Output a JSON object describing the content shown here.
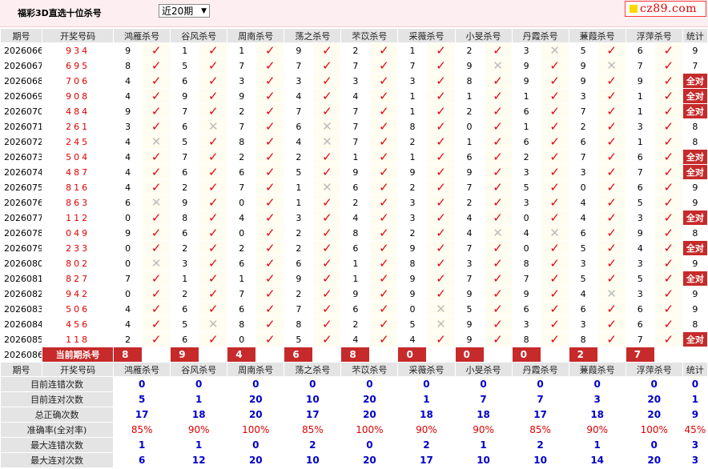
{
  "header": {
    "title": "福彩3D直选十位杀号",
    "period_select": "近20期",
    "logo_text": "cz89.com"
  },
  "columns": [
    "期号",
    "开奖号码",
    "鸿雁杀号",
    "谷风杀号",
    "周南杀号",
    "荡之杀号",
    "芣苡杀号",
    "采薇杀号",
    "小旻杀号",
    "丹霞杀号",
    "蒹葭杀号",
    "浮萍杀号",
    "统计"
  ],
  "rows": [
    {
      "issue": "2026066",
      "win": "934",
      "kills": [
        [
          "9",
          1
        ],
        [
          "1",
          1
        ],
        [
          "1",
          1
        ],
        [
          "9",
          1
        ],
        [
          "2",
          1
        ],
        [
          "1",
          1
        ],
        [
          "2",
          1
        ],
        [
          "3",
          0
        ],
        [
          "5",
          1
        ],
        [
          "6",
          1
        ]
      ],
      "stat": "9"
    },
    {
      "issue": "2026067",
      "win": "695",
      "kills": [
        [
          "8",
          1
        ],
        [
          "5",
          1
        ],
        [
          "7",
          1
        ],
        [
          "7",
          1
        ],
        [
          "7",
          1
        ],
        [
          "7",
          1
        ],
        [
          "9",
          0
        ],
        [
          "9",
          1
        ],
        [
          "9",
          0
        ],
        [
          "7",
          1
        ]
      ],
      "stat": "7"
    },
    {
      "issue": "2026068",
      "win": "706",
      "kills": [
        [
          "4",
          1
        ],
        [
          "6",
          1
        ],
        [
          "3",
          1
        ],
        [
          "3",
          1
        ],
        [
          "3",
          1
        ],
        [
          "3",
          1
        ],
        [
          "8",
          1
        ],
        [
          "9",
          1
        ],
        [
          "9",
          1
        ],
        [
          "9",
          1
        ]
      ],
      "stat": "全对"
    },
    {
      "issue": "2026069",
      "win": "908",
      "kills": [
        [
          "4",
          1
        ],
        [
          "9",
          1
        ],
        [
          "9",
          1
        ],
        [
          "4",
          1
        ],
        [
          "4",
          1
        ],
        [
          "1",
          1
        ],
        [
          "1",
          1
        ],
        [
          "1",
          1
        ],
        [
          "3",
          1
        ],
        [
          "1",
          1
        ]
      ],
      "stat": "全对"
    },
    {
      "issue": "2026070",
      "win": "484",
      "kills": [
        [
          "9",
          1
        ],
        [
          "7",
          1
        ],
        [
          "2",
          1
        ],
        [
          "7",
          1
        ],
        [
          "7",
          1
        ],
        [
          "1",
          1
        ],
        [
          "2",
          1
        ],
        [
          "6",
          1
        ],
        [
          "7",
          1
        ],
        [
          "1",
          1
        ]
      ],
      "stat": "全对"
    },
    {
      "issue": "2026071",
      "win": "261",
      "kills": [
        [
          "3",
          1
        ],
        [
          "6",
          0
        ],
        [
          "7",
          1
        ],
        [
          "6",
          0
        ],
        [
          "7",
          1
        ],
        [
          "8",
          1
        ],
        [
          "0",
          1
        ],
        [
          "1",
          1
        ],
        [
          "2",
          1
        ],
        [
          "3",
          1
        ]
      ],
      "stat": "8"
    },
    {
      "issue": "2026072",
      "win": "245",
      "kills": [
        [
          "4",
          0
        ],
        [
          "5",
          1
        ],
        [
          "8",
          1
        ],
        [
          "4",
          0
        ],
        [
          "7",
          1
        ],
        [
          "2",
          1
        ],
        [
          "1",
          1
        ],
        [
          "6",
          1
        ],
        [
          "6",
          1
        ],
        [
          "1",
          1
        ]
      ],
      "stat": "8"
    },
    {
      "issue": "2026073",
      "win": "504",
      "kills": [
        [
          "4",
          1
        ],
        [
          "7",
          1
        ],
        [
          "2",
          1
        ],
        [
          "2",
          1
        ],
        [
          "1",
          1
        ],
        [
          "1",
          1
        ],
        [
          "6",
          1
        ],
        [
          "2",
          1
        ],
        [
          "7",
          1
        ],
        [
          "6",
          1
        ]
      ],
      "stat": "全对"
    },
    {
      "issue": "2026074",
      "win": "487",
      "kills": [
        [
          "4",
          1
        ],
        [
          "6",
          1
        ],
        [
          "6",
          1
        ],
        [
          "5",
          1
        ],
        [
          "9",
          1
        ],
        [
          "9",
          1
        ],
        [
          "9",
          1
        ],
        [
          "3",
          1
        ],
        [
          "3",
          1
        ],
        [
          "7",
          1
        ]
      ],
      "stat": "全对"
    },
    {
      "issue": "2026075",
      "win": "816",
      "kills": [
        [
          "4",
          1
        ],
        [
          "2",
          1
        ],
        [
          "7",
          1
        ],
        [
          "1",
          0
        ],
        [
          "6",
          1
        ],
        [
          "2",
          1
        ],
        [
          "7",
          1
        ],
        [
          "5",
          1
        ],
        [
          "0",
          1
        ],
        [
          "6",
          1
        ]
      ],
      "stat": "9"
    },
    {
      "issue": "2026076",
      "win": "863",
      "kills": [
        [
          "6",
          0
        ],
        [
          "9",
          1
        ],
        [
          "0",
          1
        ],
        [
          "1",
          1
        ],
        [
          "2",
          1
        ],
        [
          "3",
          1
        ],
        [
          "2",
          1
        ],
        [
          "3",
          1
        ],
        [
          "4",
          1
        ],
        [
          "5",
          1
        ]
      ],
      "stat": "9"
    },
    {
      "issue": "2026077",
      "win": "112",
      "kills": [
        [
          "0",
          1
        ],
        [
          "8",
          1
        ],
        [
          "4",
          1
        ],
        [
          "3",
          1
        ],
        [
          "4",
          1
        ],
        [
          "3",
          1
        ],
        [
          "4",
          1
        ],
        [
          "0",
          1
        ],
        [
          "4",
          1
        ],
        [
          "3",
          1
        ]
      ],
      "stat": "全对"
    },
    {
      "issue": "2026078",
      "win": "049",
      "kills": [
        [
          "9",
          1
        ],
        [
          "6",
          1
        ],
        [
          "0",
          1
        ],
        [
          "2",
          1
        ],
        [
          "8",
          1
        ],
        [
          "2",
          1
        ],
        [
          "4",
          0
        ],
        [
          "4",
          0
        ],
        [
          "6",
          1
        ],
        [
          "9",
          1
        ]
      ],
      "stat": "8"
    },
    {
      "issue": "2026079",
      "win": "233",
      "kills": [
        [
          "0",
          1
        ],
        [
          "2",
          1
        ],
        [
          "2",
          1
        ],
        [
          "2",
          1
        ],
        [
          "6",
          1
        ],
        [
          "9",
          1
        ],
        [
          "7",
          1
        ],
        [
          "0",
          1
        ],
        [
          "5",
          1
        ],
        [
          "4",
          1
        ]
      ],
      "stat": "全对"
    },
    {
      "issue": "2026080",
      "win": "802",
      "kills": [
        [
          "0",
          0
        ],
        [
          "3",
          1
        ],
        [
          "6",
          1
        ],
        [
          "6",
          1
        ],
        [
          "1",
          1
        ],
        [
          "8",
          1
        ],
        [
          "3",
          1
        ],
        [
          "8",
          1
        ],
        [
          "3",
          1
        ],
        [
          "3",
          1
        ]
      ],
      "stat": "9"
    },
    {
      "issue": "2026081",
      "win": "827",
      "kills": [
        [
          "7",
          1
        ],
        [
          "1",
          1
        ],
        [
          "1",
          1
        ],
        [
          "9",
          1
        ],
        [
          "1",
          1
        ],
        [
          "9",
          1
        ],
        [
          "7",
          1
        ],
        [
          "7",
          1
        ],
        [
          "5",
          1
        ],
        [
          "5",
          1
        ]
      ],
      "stat": "全对"
    },
    {
      "issue": "2026082",
      "win": "942",
      "kills": [
        [
          "0",
          1
        ],
        [
          "2",
          1
        ],
        [
          "7",
          1
        ],
        [
          "2",
          1
        ],
        [
          "9",
          1
        ],
        [
          "9",
          1
        ],
        [
          "9",
          1
        ],
        [
          "9",
          1
        ],
        [
          "4",
          0
        ],
        [
          "3",
          1
        ]
      ],
      "stat": "9"
    },
    {
      "issue": "2026083",
      "win": "506",
      "kills": [
        [
          "4",
          1
        ],
        [
          "6",
          1
        ],
        [
          "6",
          1
        ],
        [
          "7",
          1
        ],
        [
          "6",
          1
        ],
        [
          "0",
          0
        ],
        [
          "5",
          1
        ],
        [
          "6",
          1
        ],
        [
          "6",
          1
        ],
        [
          "6",
          1
        ]
      ],
      "stat": "9"
    },
    {
      "issue": "2026084",
      "win": "456",
      "kills": [
        [
          "4",
          1
        ],
        [
          "5",
          0
        ],
        [
          "8",
          1
        ],
        [
          "8",
          1
        ],
        [
          "2",
          1
        ],
        [
          "5",
          0
        ],
        [
          "9",
          1
        ],
        [
          "3",
          1
        ],
        [
          "3",
          1
        ],
        [
          "6",
          1
        ]
      ],
      "stat": "8"
    },
    {
      "issue": "2026085",
      "win": "118",
      "kills": [
        [
          "2",
          1
        ],
        [
          "6",
          1
        ],
        [
          "0",
          1
        ],
        [
          "5",
          1
        ],
        [
          "4",
          1
        ],
        [
          "4",
          1
        ],
        [
          "9",
          1
        ],
        [
          "8",
          1
        ],
        [
          "8",
          1
        ],
        [
          "7",
          1
        ]
      ],
      "stat": "全对"
    }
  ],
  "current": {
    "issue": "2026086",
    "label": "当前期杀号",
    "kills": [
      "8",
      "9",
      "4",
      "6",
      "8",
      "0",
      "0",
      "0",
      "2",
      "7"
    ]
  },
  "stats": [
    {
      "label": "目前连错次数",
      "values": [
        "0",
        "0",
        "0",
        "0",
        "0",
        "0",
        "0",
        "0",
        "0",
        "0",
        "0"
      ],
      "kind": "val"
    },
    {
      "label": "目前连对次数",
      "values": [
        "5",
        "1",
        "20",
        "10",
        "20",
        "1",
        "7",
        "7",
        "3",
        "20",
        "1"
      ],
      "kind": "val"
    },
    {
      "label": "总正确次数",
      "values": [
        "17",
        "18",
        "20",
        "17",
        "20",
        "18",
        "18",
        "17",
        "18",
        "20",
        "9"
      ],
      "kind": "val"
    },
    {
      "label": "准确率(全对率)",
      "values": [
        "85%",
        "90%",
        "100%",
        "85%",
        "100%",
        "90%",
        "90%",
        "85%",
        "90%",
        "100%",
        "45%"
      ],
      "kind": "rate"
    },
    {
      "label": "最大连错次数",
      "values": [
        "1",
        "1",
        "0",
        "2",
        "0",
        "2",
        "1",
        "2",
        "1",
        "0",
        "3"
      ],
      "kind": "val"
    },
    {
      "label": "最大连对次数",
      "values": [
        "6",
        "12",
        "20",
        "10",
        "20",
        "17",
        "10",
        "10",
        "14",
        "20",
        "3"
      ],
      "kind": "val"
    }
  ],
  "icons": {
    "correct": "check-icon",
    "wrong": "cross-icon"
  },
  "colors": {
    "accent": "#e00000",
    "header_bg": "#e4e4e4",
    "all_correct_bg": "#c72a2a",
    "stat_value": "#0000cc"
  }
}
